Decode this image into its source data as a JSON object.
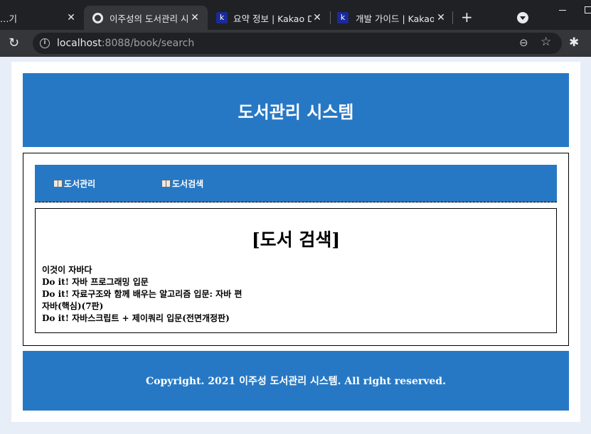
{
  "browser": {
    "tabs": [
      {
        "title": "…기",
        "favicon": "none"
      },
      {
        "title": "이주성의 도서관리 시",
        "favicon": "globe-icon"
      },
      {
        "title": "요약 정보 | Kakao D",
        "favicon": "kakao-k-icon"
      },
      {
        "title": "개발 가이드 | Kakao",
        "favicon": "kakao-k-icon"
      }
    ],
    "new_tab_glyph": "+",
    "url_host": "localhost",
    "url_rest": ":8088/book/search"
  },
  "page": {
    "header_title": "도서관리 시스템",
    "nav": [
      {
        "label": "도서관리"
      },
      {
        "label": "도서검색"
      }
    ],
    "search_title": "[도서 검색]",
    "books": [
      "이것이 자바다",
      "Do it! 자바 프로그래밍 입문",
      "Do it! 자료구조와 함께 배우는 알고리즘 입문: 자바 편",
      "자바(핵심)(7판)",
      "Do it! 자바스크립트 + 제이쿼리 입문(전면개정판)"
    ],
    "footer_text": "Copyright. 2021 이주성 도서관리 시스템. All right reserved.",
    "colors": {
      "accent": "#2778c4",
      "background": "#e8eef7"
    }
  }
}
